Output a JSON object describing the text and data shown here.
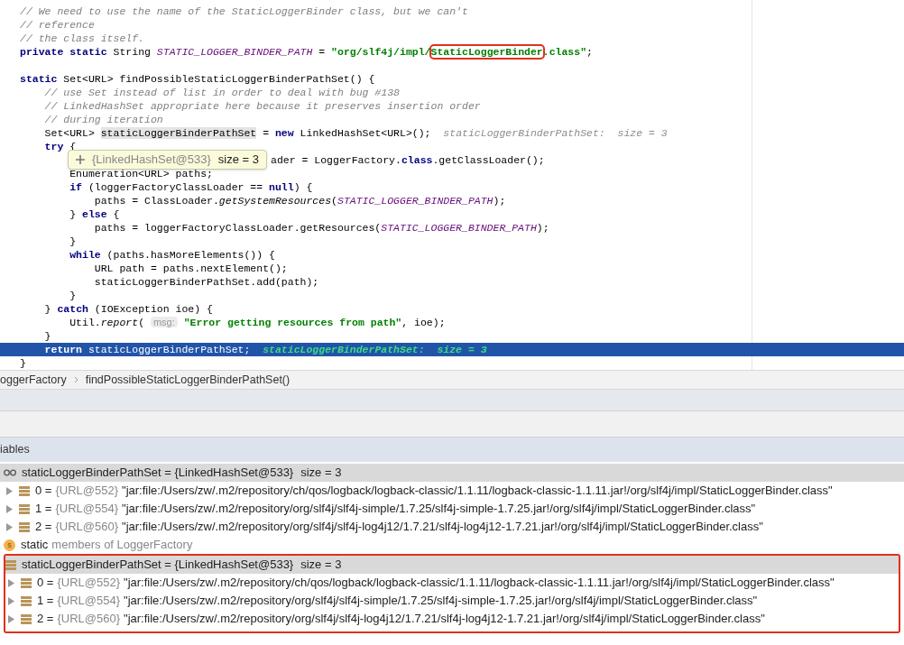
{
  "code": {
    "lines": [
      {
        "kind": "code",
        "segments": [
          {
            "kind": "comment",
            "text": "// We need to use the name of the StaticLoggerBinder class, but we can't"
          }
        ]
      },
      {
        "kind": "code",
        "segments": [
          {
            "kind": "comment",
            "text": "// reference"
          }
        ]
      },
      {
        "kind": "code",
        "segments": [
          {
            "kind": "comment",
            "text": "// the class itself."
          }
        ]
      },
      {
        "kind": "code",
        "segments": [
          {
            "kind": "keyword",
            "text": "private static"
          },
          {
            "kind": "plain",
            "text": " String "
          },
          {
            "kind": "constant",
            "text": "STATIC_LOGGER_BINDER_PATH"
          },
          {
            "kind": "plain",
            "text": " = "
          },
          {
            "kind": "string",
            "text": "\"org/slf4j/impl/"
          },
          {
            "kind": "string",
            "text": "StaticLoggerBinder",
            "boxed": true
          },
          {
            "kind": "string",
            "text": ".class\""
          },
          {
            "kind": "plain",
            "text": ";"
          }
        ]
      },
      {
        "kind": "blank"
      },
      {
        "kind": "code",
        "segments": [
          {
            "kind": "keyword",
            "text": "static"
          },
          {
            "kind": "plain",
            "text": " Set<URL> findPossibleStaticLoggerBinderPathSet() {"
          }
        ]
      },
      {
        "kind": "code",
        "segments": [
          {
            "kind": "comment",
            "text": "    // use Set instead of list in order to deal with bug #138"
          }
        ]
      },
      {
        "kind": "code",
        "segments": [
          {
            "kind": "comment",
            "text": "    // LinkedHashSet appropriate here because it preserves insertion order"
          }
        ]
      },
      {
        "kind": "code",
        "segments": [
          {
            "kind": "comment",
            "text": "    // during iteration"
          }
        ]
      },
      {
        "kind": "code",
        "segments": [
          {
            "kind": "plain",
            "text": "    Set<URL> "
          },
          {
            "kind": "shaded",
            "text": "staticLoggerBinderPathSet"
          },
          {
            "kind": "plain",
            "text": " = "
          },
          {
            "kind": "keyword",
            "text": "new"
          },
          {
            "kind": "plain",
            "text": " LinkedHashSet<URL>();  "
          },
          {
            "kind": "hint",
            "text": "staticLoggerBinderPathSet:  size = 3"
          }
        ]
      },
      {
        "kind": "code",
        "segments": [
          {
            "kind": "keyword",
            "text": "    try"
          },
          {
            "kind": "plain",
            "text": " {"
          }
        ]
      },
      {
        "kind": "partial",
        "segments": [
          {
            "kind": "plain",
            "text": "ader = LoggerFactory."
          },
          {
            "kind": "keyword",
            "text": "class"
          },
          {
            "kind": "plain",
            "text": ".getClassLoader();"
          }
        ]
      },
      {
        "kind": "code",
        "segments": [
          {
            "kind": "plain",
            "text": "        Enumeration<URL> paths;"
          }
        ]
      },
      {
        "kind": "code",
        "segments": [
          {
            "kind": "keyword",
            "text": "        if"
          },
          {
            "kind": "plain",
            "text": " (loggerFactoryClassLoader == "
          },
          {
            "kind": "keyword",
            "text": "null"
          },
          {
            "kind": "plain",
            "text": ") {"
          }
        ]
      },
      {
        "kind": "code",
        "segments": [
          {
            "kind": "plain",
            "text": "            paths = ClassLoader."
          },
          {
            "kind": "static-call",
            "text": "getSystemResources"
          },
          {
            "kind": "plain",
            "text": "("
          },
          {
            "kind": "constant",
            "text": "STATIC_LOGGER_BINDER_PATH"
          },
          {
            "kind": "plain",
            "text": ");"
          }
        ]
      },
      {
        "kind": "code",
        "segments": [
          {
            "kind": "plain",
            "text": "        } "
          },
          {
            "kind": "keyword",
            "text": "else"
          },
          {
            "kind": "plain",
            "text": " {"
          }
        ]
      },
      {
        "kind": "code",
        "segments": [
          {
            "kind": "plain",
            "text": "            paths = loggerFactoryClassLoader.getResources("
          },
          {
            "kind": "constant",
            "text": "STATIC_LOGGER_BINDER_PATH"
          },
          {
            "kind": "plain",
            "text": ");"
          }
        ]
      },
      {
        "kind": "code",
        "segments": [
          {
            "kind": "plain",
            "text": "        }"
          }
        ]
      },
      {
        "kind": "code",
        "segments": [
          {
            "kind": "keyword",
            "text": "        while"
          },
          {
            "kind": "plain",
            "text": " (paths.hasMoreElements()) {"
          }
        ]
      },
      {
        "kind": "code",
        "segments": [
          {
            "kind": "plain",
            "text": "            URL path = paths.nextElement();"
          }
        ]
      },
      {
        "kind": "code",
        "segments": [
          {
            "kind": "plain",
            "text": "            staticLoggerBinderPathSet.add(path);"
          }
        ]
      },
      {
        "kind": "code",
        "segments": [
          {
            "kind": "plain",
            "text": "        }"
          }
        ]
      },
      {
        "kind": "code",
        "segments": [
          {
            "kind": "plain",
            "text": "    } "
          },
          {
            "kind": "keyword",
            "text": "catch"
          },
          {
            "kind": "plain",
            "text": " (IOException ioe) {"
          }
        ]
      },
      {
        "kind": "code",
        "segments": [
          {
            "kind": "plain",
            "text": "        Util."
          },
          {
            "kind": "static-call",
            "text": "report"
          },
          {
            "kind": "plain",
            "text": "( "
          },
          {
            "kind": "param-hint",
            "text": "msg:"
          },
          {
            "kind": "string",
            "text": " \"Error getting resources from path\""
          },
          {
            "kind": "plain",
            "text": ", ioe);"
          }
        ]
      },
      {
        "kind": "code",
        "segments": [
          {
            "kind": "plain",
            "text": "    }"
          }
        ]
      },
      {
        "kind": "current",
        "segments": [
          {
            "kind": "keyword",
            "text": "    return"
          },
          {
            "kind": "plain",
            "text": " staticLoggerBinderPathSet;  "
          },
          {
            "kind": "hint",
            "text": "staticLoggerBinderPathSet:  size = 3"
          }
        ]
      },
      {
        "kind": "code",
        "segments": [
          {
            "kind": "plain",
            "text": "}"
          }
        ]
      }
    ],
    "tooltip": {
      "value": "{LinkedHashSet@533}",
      "size": "size = 3"
    }
  },
  "breadcrumbs": [
    "oggerFactory",
    "findPossibleStaticLoggerBinderPathSet()"
  ],
  "variables": {
    "header": "iables",
    "items": [
      {
        "kind": "watch",
        "name": "staticLoggerBinderPathSet = {LinkedHashSet@533}",
        "size": "size = 3",
        "selected": true,
        "boxed": false,
        "children": [
          {
            "name": "0 =",
            "ref": "{URL@552}",
            "value": "\"jar:file:/Users/zw/.m2/repository/ch/qos/logback/logback-classic/1.1.11/logback-classic-1.1.11.jar!/org/slf4j/impl/StaticLoggerBinder.class\"",
            "expanded": false
          },
          {
            "name": "1 =",
            "ref": "{URL@554}",
            "value": "\"jar:file:/Users/zw/.m2/repository/org/slf4j/slf4j-simple/1.7.25/slf4j-simple-1.7.25.jar!/org/slf4j/impl/StaticLoggerBinder.class\"",
            "expanded": false
          },
          {
            "name": "2 =",
            "ref": "{URL@560}",
            "value": "\"jar:file:/Users/zw/.m2/repository/org/slf4j/slf4j-log4j12/1.7.21/slf4j-log4j12-1.7.21.jar!/org/slf4j/impl/StaticLoggerBinder.class\"",
            "expanded": false
          }
        ]
      },
      {
        "kind": "static",
        "badge": "s",
        "name": "static",
        "text": "members of LoggerFactory",
        "selected": false,
        "boxed": false
      },
      {
        "kind": "field",
        "name": "staticLoggerBinderPathSet = {LinkedHashSet@533}",
        "size": "size = 3",
        "selected": true,
        "boxed": true,
        "children": [
          {
            "name": "0 =",
            "ref": "{URL@552}",
            "value": "\"jar:file:/Users/zw/.m2/repository/ch/qos/logback/logback-classic/1.1.11/logback-classic-1.1.11.jar!/org/slf4j/impl/StaticLoggerBinder.class\"",
            "expanded": false
          },
          {
            "name": "1 =",
            "ref": "{URL@554}",
            "value": "\"jar:file:/Users/zw/.m2/repository/org/slf4j/slf4j-simple/1.7.25/slf4j-simple-1.7.25.jar!/org/slf4j/impl/StaticLoggerBinder.class\"",
            "expanded": false
          },
          {
            "name": "2 =",
            "ref": "{URL@560}",
            "value": "\"jar:file:/Users/zw/.m2/repository/org/slf4j/slf4j-log4j12/1.7.21/slf4j-log4j12-1.7.21.jar!/org/slf4j/impl/StaticLoggerBinder.class\"",
            "expanded": false
          }
        ]
      }
    ]
  }
}
